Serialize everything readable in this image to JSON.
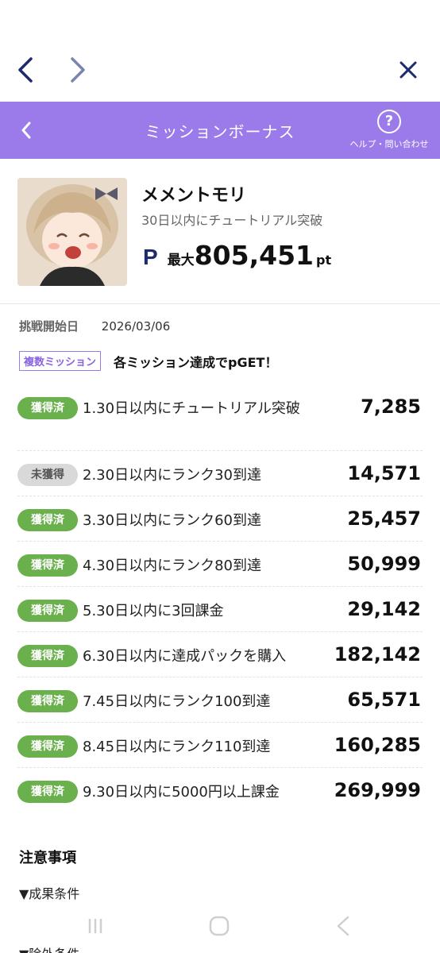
{
  "header": {
    "title": "ミッションボーナス",
    "help_label": "ヘルプ・問い合わせ",
    "help_glyph": "?"
  },
  "game": {
    "name": "メメントモリ",
    "subtitle": "30日以内にチュートリアル突破",
    "logo": "P",
    "points_prefix": "最大",
    "points_value": "805,451",
    "points_unit": "pt"
  },
  "challenge": {
    "start_label": "挑戦開始日",
    "start_date": "2026/03/06",
    "multi_tag": "複数ミッション",
    "multi_text": "各ミッション達成でpGET！"
  },
  "missions": [
    {
      "status": "獲得済",
      "text": "1.30日以内にチュートリアル突破",
      "points": "7,285"
    },
    {
      "status": "未獲得",
      "text": "2.30日以内にランク30到達",
      "points": "14,571"
    },
    {
      "status": "獲得済",
      "text": "3.30日以内にランク60到達",
      "points": "25,457"
    },
    {
      "status": "獲得済",
      "text": "4.30日以内にランク80到達",
      "points": "50,999"
    },
    {
      "status": "獲得済",
      "text": "5.30日以内に3回課金",
      "points": "29,142"
    },
    {
      "status": "獲得済",
      "text": "6.30日以内に達成パックを購入",
      "points": "182,142"
    },
    {
      "status": "獲得済",
      "text": "7.45日以内にランク100到達",
      "points": "65,571"
    },
    {
      "status": "獲得済",
      "text": "8.45日以内にランク110到達",
      "points": "160,285"
    },
    {
      "status": "獲得済",
      "text": "9.30日以内に5000円以上課金",
      "points": "269,999"
    }
  ],
  "notes": {
    "title": "注意事項",
    "condition": "▼成果条件",
    "next_partial": "▼除外条件"
  },
  "colors": {
    "header_bg": "#9b7bea",
    "badge_got": "#6ab04c",
    "badge_not": "#d9d9d9",
    "nav_icon": "#1d2a6b"
  },
  "icons": {
    "back": "chevron-left-icon",
    "forward": "chevron-right-icon",
    "close": "close-icon",
    "help": "question-circle-icon"
  }
}
